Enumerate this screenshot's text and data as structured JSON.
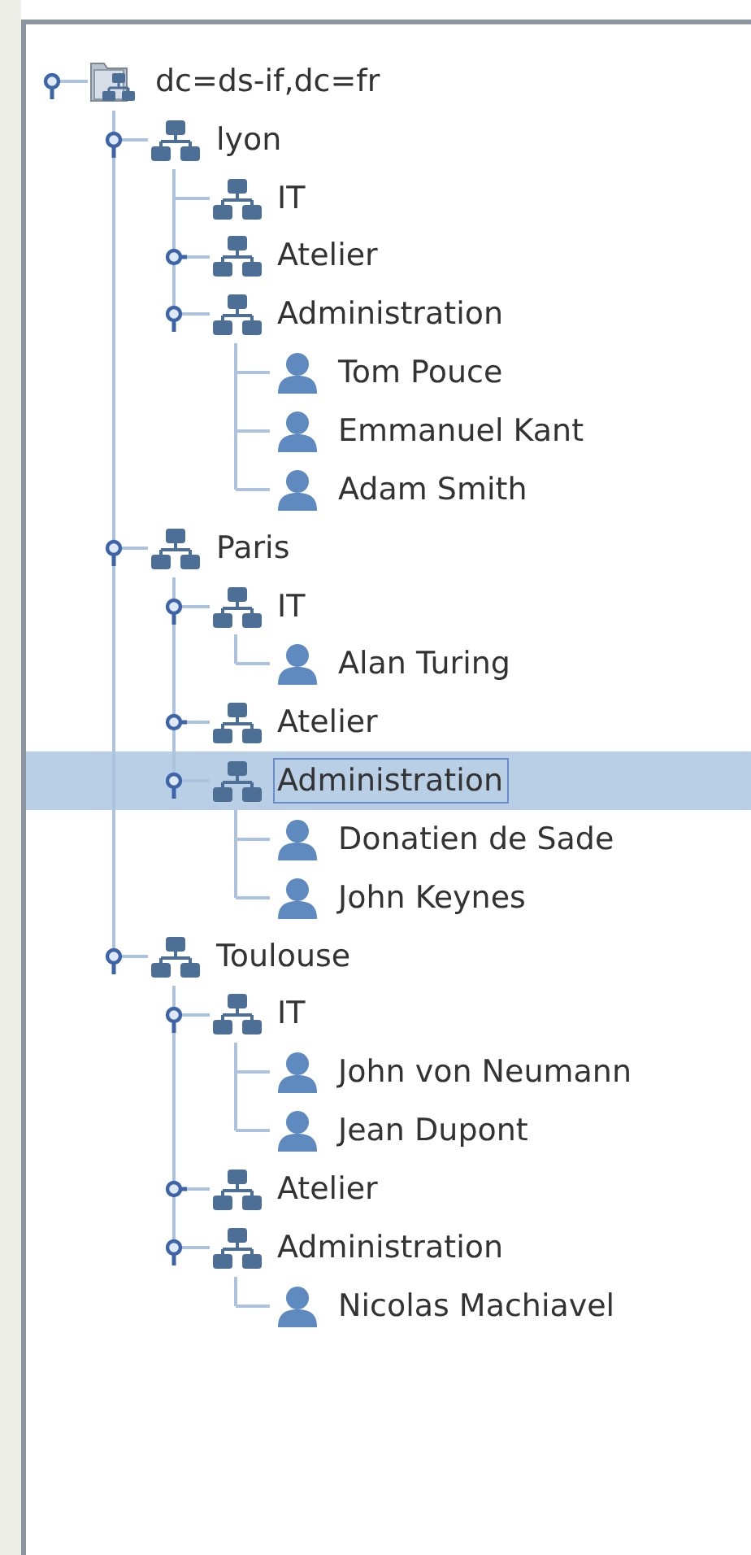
{
  "tree": {
    "root": {
      "label": "dc=ds-if,dc=fr",
      "kind": "root",
      "expanded": true,
      "selected": false,
      "children": [
        {
          "label": "lyon",
          "kind": "unit",
          "expanded": true,
          "selected": false,
          "children": [
            {
              "label": "IT",
              "kind": "unit",
              "selected": false
            },
            {
              "label": "Atelier",
              "kind": "unit",
              "expanded": false,
              "selected": false
            },
            {
              "label": "Administration",
              "kind": "unit",
              "expanded": true,
              "selected": false,
              "children": [
                {
                  "label": "Tom Pouce",
                  "kind": "person",
                  "selected": false
                },
                {
                  "label": "Emmanuel Kant",
                  "kind": "person",
                  "selected": false
                },
                {
                  "label": "Adam Smith",
                  "kind": "person",
                  "selected": false
                }
              ]
            }
          ]
        },
        {
          "label": "Paris",
          "kind": "unit",
          "expanded": true,
          "selected": false,
          "children": [
            {
              "label": "IT",
              "kind": "unit",
              "expanded": true,
              "selected": false,
              "children": [
                {
                  "label": "Alan Turing",
                  "kind": "person",
                  "selected": false
                }
              ]
            },
            {
              "label": "Atelier",
              "kind": "unit",
              "expanded": false,
              "selected": false
            },
            {
              "label": "Administration",
              "kind": "unit",
              "expanded": true,
              "selected": true,
              "children": [
                {
                  "label": "Donatien de Sade",
                  "kind": "person",
                  "selected": false
                },
                {
                  "label": "John Keynes",
                  "kind": "person",
                  "selected": false
                }
              ]
            }
          ]
        },
        {
          "label": "Toulouse",
          "kind": "unit",
          "expanded": true,
          "selected": false,
          "children": [
            {
              "label": "IT",
              "kind": "unit",
              "expanded": true,
              "selected": false,
              "children": [
                {
                  "label": "John von Neumann",
                  "kind": "person",
                  "selected": false
                },
                {
                  "label": "Jean Dupont",
                  "kind": "person",
                  "selected": false
                }
              ]
            },
            {
              "label": "Atelier",
              "kind": "unit",
              "expanded": false,
              "selected": false
            },
            {
              "label": "Administration",
              "kind": "unit",
              "expanded": true,
              "selected": false,
              "children": [
                {
                  "label": "Nicolas Machiavel",
                  "kind": "person",
                  "selected": false
                }
              ]
            }
          ]
        }
      ]
    }
  }
}
